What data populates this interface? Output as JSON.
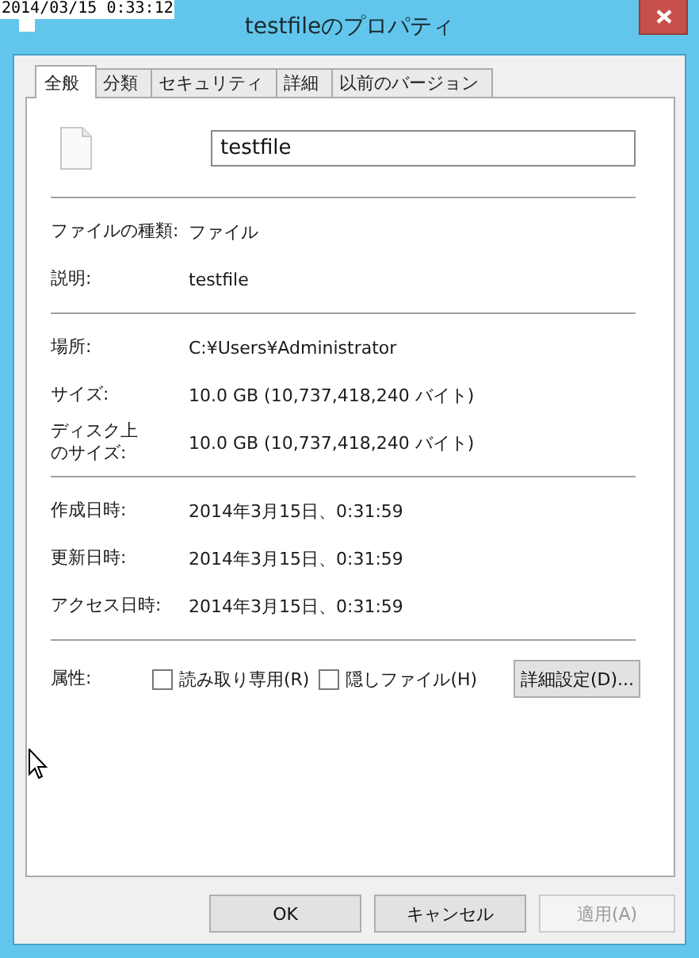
{
  "timestamp": "2014/03/15 0:33:12",
  "window": {
    "title": "testfileのプロパティ"
  },
  "tabs": [
    {
      "label": "全般",
      "selected": true
    },
    {
      "label": "分類",
      "selected": false
    },
    {
      "label": "セキュリティ",
      "selected": false
    },
    {
      "label": "詳細",
      "selected": false
    },
    {
      "label": "以前のバージョン",
      "selected": false
    }
  ],
  "file_name": "testfile",
  "sections": [
    {
      "rows": [
        {
          "label": "ファイルの種類:",
          "value": "ファイル"
        },
        {
          "label": "説明:",
          "value": "testfile"
        }
      ]
    },
    {
      "rows": [
        {
          "label": "場所:",
          "value": "C:¥Users¥Administrator"
        },
        {
          "label": "サイズ:",
          "value": "10.0 GB (10,737,418,240 バイト)"
        },
        {
          "label_lines": [
            "ディスク上",
            "のサイズ:"
          ],
          "value": "10.0 GB (10,737,418,240 バイト)"
        }
      ]
    },
    {
      "rows": [
        {
          "label": "作成日時:",
          "value": "2014年3月15日、0:31:59"
        },
        {
          "label": "更新日時:",
          "value": "2014年3月15日、0:31:59"
        },
        {
          "label": "アクセス日時:",
          "value": "2014年3月15日、0:31:59"
        }
      ]
    }
  ],
  "attributes": {
    "label": "属性:",
    "checkboxes": [
      {
        "label": "読み取り専用(R)",
        "checked": false
      },
      {
        "label": "隠しファイル(H)",
        "checked": false
      }
    ],
    "button": "詳細設定(D)..."
  },
  "buttons": [
    {
      "label": "OK",
      "disabled": false
    },
    {
      "label": "キャンセル",
      "disabled": false
    },
    {
      "label": "適用(A)",
      "disabled": true
    }
  ]
}
